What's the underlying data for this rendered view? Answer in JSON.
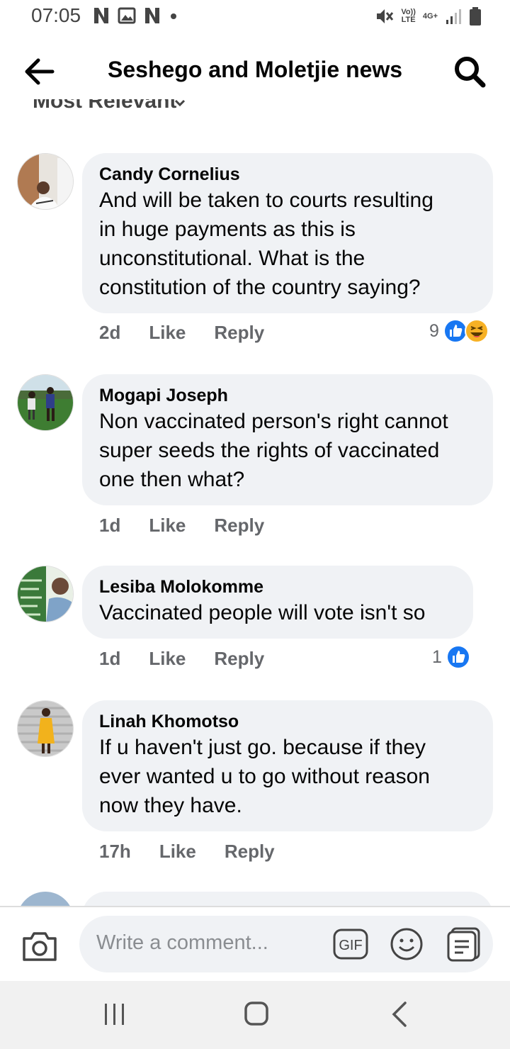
{
  "status_bar": {
    "time": "07:05",
    "left_icons": [
      "netflix-n-icon",
      "gallery-icon",
      "netflix-n-icon",
      "dot-icon"
    ],
    "volte_label": "Vo))\nLTE",
    "network_label": "4G+",
    "right_icons": [
      "mute-icon",
      "signal-icon",
      "battery-icon"
    ]
  },
  "header": {
    "title": "Seshego and Moletjie news",
    "back_icon": "arrow-left-icon",
    "search_icon": "search-icon"
  },
  "sort": {
    "label": "Most Relevant",
    "icon": "chevron-down-icon"
  },
  "comments": [
    {
      "author": "Candy Cornelius",
      "lines": [
        "And will be taken to courts resulting",
        "in huge payments as this is",
        "unconstitutional. What is the",
        "constitution of the country saying?"
      ],
      "time": "2d",
      "like": "Like",
      "reply": "Reply",
      "reaction_count": "9",
      "reactions": [
        "like-reaction-icon",
        "haha-reaction-icon"
      ]
    },
    {
      "author": "Mogapi Joseph",
      "lines": [
        "Non vaccinated person's right cannot",
        "super seeds the rights of vaccinated",
        "one then what?"
      ],
      "time": "1d",
      "like": "Like",
      "reply": "Reply"
    },
    {
      "author": "Lesiba Molokomme",
      "lines": [
        "Vaccinated people will vote isn't so"
      ],
      "time": "1d",
      "like": "Like",
      "reply": "Reply",
      "reaction_count": "1",
      "reactions": [
        "like-reaction-icon"
      ]
    },
    {
      "author": "Linah Khomotso",
      "lines": [
        "If u haven't just go. because if they",
        "ever wanted u to go without reason",
        "now they have."
      ],
      "time": "17h",
      "like": "Like",
      "reply": "Reply"
    }
  ],
  "composer": {
    "placeholder": "Write a comment...",
    "gif_label": "GIF"
  },
  "colors": {
    "bubble": "#f0f2f5",
    "meta_text": "#65676b",
    "like_blue": "#1877f2",
    "haha_yellow": "#f7b125"
  }
}
